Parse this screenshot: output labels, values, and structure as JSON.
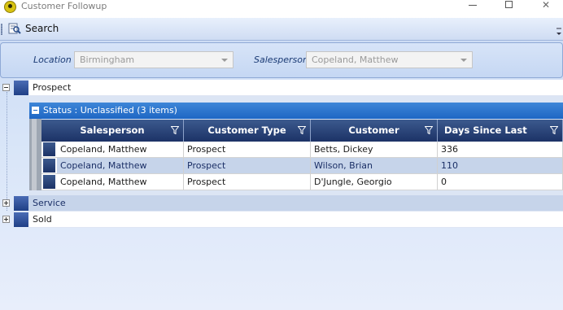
{
  "window": {
    "title": "Customer Followup"
  },
  "toolbar": {
    "search_label": "Search"
  },
  "filters": {
    "location_label": "Location",
    "location_value": "Birmingham",
    "salesperson_label": "Salesperson",
    "salesperson_value": "Copeland, Matthew"
  },
  "groups": [
    {
      "label": "Prospect",
      "expanded": true
    },
    {
      "label": "Service",
      "expanded": false
    },
    {
      "label": "Sold",
      "expanded": false
    }
  ],
  "status_group": {
    "label": "Status : Unclassified (3 items)"
  },
  "table": {
    "columns": [
      "Salesperson",
      "Customer Type",
      "Customer",
      "Days Since Last Activit"
    ],
    "rows": [
      [
        "Copeland, Matthew",
        "Prospect",
        "Betts, Dickey",
        "336"
      ],
      [
        "Copeland, Matthew",
        "Prospect",
        "Wilson, Brian",
        "110"
      ],
      [
        "Copeland, Matthew",
        "Prospect",
        "D'Jungle, Georgio",
        "0"
      ]
    ]
  },
  "colors": {
    "header_bg": "#1c3266",
    "status_bar_bg": "#1e66c4",
    "alt_row_bg": "#c6d4ea"
  },
  "icons": {
    "app": "app-logo-icon",
    "search": "search-icon",
    "filter": "filter-funnel-icon",
    "minimize": "minimize-icon",
    "maximize": "maximize-icon",
    "close": "close-icon"
  }
}
